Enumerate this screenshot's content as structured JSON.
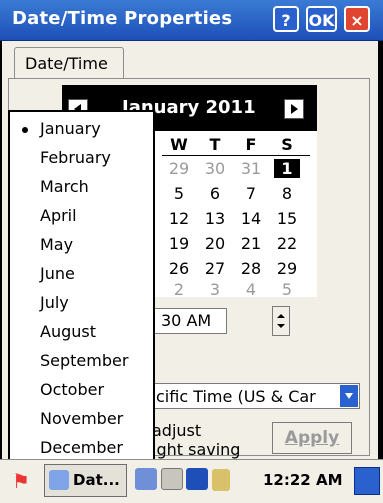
{
  "window": {
    "title": "Date/Time Properties",
    "help_label": "?",
    "ok_label": "OK",
    "close_label": "×"
  },
  "tabs": [
    {
      "label": "Date/Time"
    }
  ],
  "calendar": {
    "month_label": "January 2011",
    "prev_icon": "triangle-left",
    "next_icon": "triangle-right",
    "visible_weekdays": [
      "W",
      "T",
      "F",
      "S"
    ],
    "days": [
      [
        "29",
        "30",
        "31",
        "1"
      ],
      [
        "5",
        "6",
        "7",
        "8"
      ],
      [
        "12",
        "13",
        "14",
        "15"
      ],
      [
        "19",
        "20",
        "21",
        "22"
      ],
      [
        "26",
        "27",
        "28",
        "29"
      ],
      [
        "2",
        "3",
        "4",
        "5"
      ]
    ],
    "selected_day": "1"
  },
  "time": {
    "visible_value": "30 AM"
  },
  "timezone": {
    "visible_value": "cific Time (US & Car"
  },
  "dst": {
    "line1": "adjust",
    "line2": "ight saving"
  },
  "apply": {
    "label": "Apply"
  },
  "month_menu": {
    "selected": "January",
    "items": [
      "January",
      "February",
      "March",
      "April",
      "May",
      "June",
      "July",
      "August",
      "September",
      "October",
      "November",
      "December"
    ]
  },
  "taskbar": {
    "start_icon": "windows-flag",
    "task_label": "Dat...",
    "clock": "12:22 AM",
    "tray_icons": [
      "network-icon",
      "keyboard-icon",
      "input-panel-icon",
      "power-icon"
    ],
    "desktop_icon": "desktop-icon"
  },
  "colors": {
    "title_bar": "#1e4fb8",
    "close_button": "#e0452f",
    "selected_day_bg": "#000000"
  }
}
